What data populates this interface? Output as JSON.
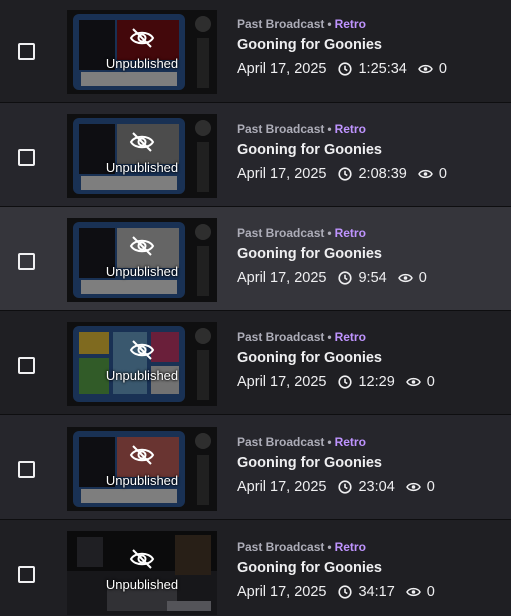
{
  "icons": {
    "unpublished": "eye-off-icon",
    "duration": "clock-icon",
    "views": "eye-icon",
    "select": "checkbox-icon"
  },
  "colors": {
    "category_accent": "#bf94ff",
    "row_odd": "#1f1f23",
    "row_even": "#26262c",
    "row_hover": "#35353b",
    "muted_text": "#adadb8"
  },
  "videos": [
    {
      "type": "Past Broadcast",
      "separator": "•",
      "category": "Retro",
      "title": "Gooning for Goonies",
      "date": "April 17, 2025",
      "duration": "1:25:34",
      "views": "0",
      "status": "Unpublished",
      "thumb_tint": "#7a0f14"
    },
    {
      "type": "Past Broadcast",
      "separator": "•",
      "category": "Retro",
      "title": "Gooning for Goonies",
      "date": "April 17, 2025",
      "duration": "2:08:39",
      "views": "0",
      "status": "Unpublished",
      "thumb_tint": "#8a8a8a"
    },
    {
      "type": "Past Broadcast",
      "separator": "•",
      "category": "Retro",
      "title": "Gooning for Goonies",
      "date": "April 17, 2025",
      "duration": "9:54",
      "views": "0",
      "status": "Unpublished",
      "thumb_tint": "#b8b8b8"
    },
    {
      "type": "Past Broadcast",
      "separator": "•",
      "category": "Retro",
      "title": "Gooning for Goonies",
      "date": "April 17, 2025",
      "duration": "12:29",
      "views": "0",
      "status": "Unpublished",
      "thumb_tint": "#6aa0c8"
    },
    {
      "type": "Past Broadcast",
      "separator": "•",
      "category": "Retro",
      "title": "Gooning for Goonies",
      "date": "April 17, 2025",
      "duration": "23:04",
      "views": "0",
      "status": "Unpublished",
      "thumb_tint": "#c0605a"
    },
    {
      "type": "Past Broadcast",
      "separator": "•",
      "category": "Retro",
      "title": "Gooning for Goonies",
      "date": "April 17, 2025",
      "duration": "34:17",
      "views": "0",
      "status": "Unpublished",
      "thumb_tint": "#3a3a40"
    }
  ]
}
